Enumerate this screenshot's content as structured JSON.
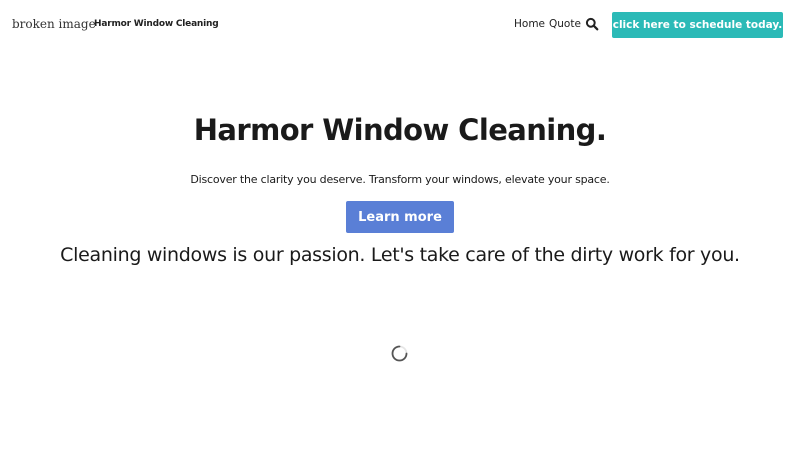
{
  "header": {
    "logo_alt": "broken image",
    "brand": "Harmor Window Cleaning",
    "nav": {
      "home": "Home",
      "quote": "Quote"
    },
    "search_icon": "search-icon",
    "cta_label": "click here to schedule today.",
    "cta_color": "#2bbab7"
  },
  "hero": {
    "title": "Harmor Window Cleaning.",
    "subtitle": "Discover the clarity you deserve. Transform your windows, elevate your space.",
    "button_label": "Learn more",
    "button_color": "#5a7fd6",
    "tagline": "Cleaning windows is our passion. Let's take care of the dirty work for you."
  },
  "loading_icon": "spinner-icon"
}
